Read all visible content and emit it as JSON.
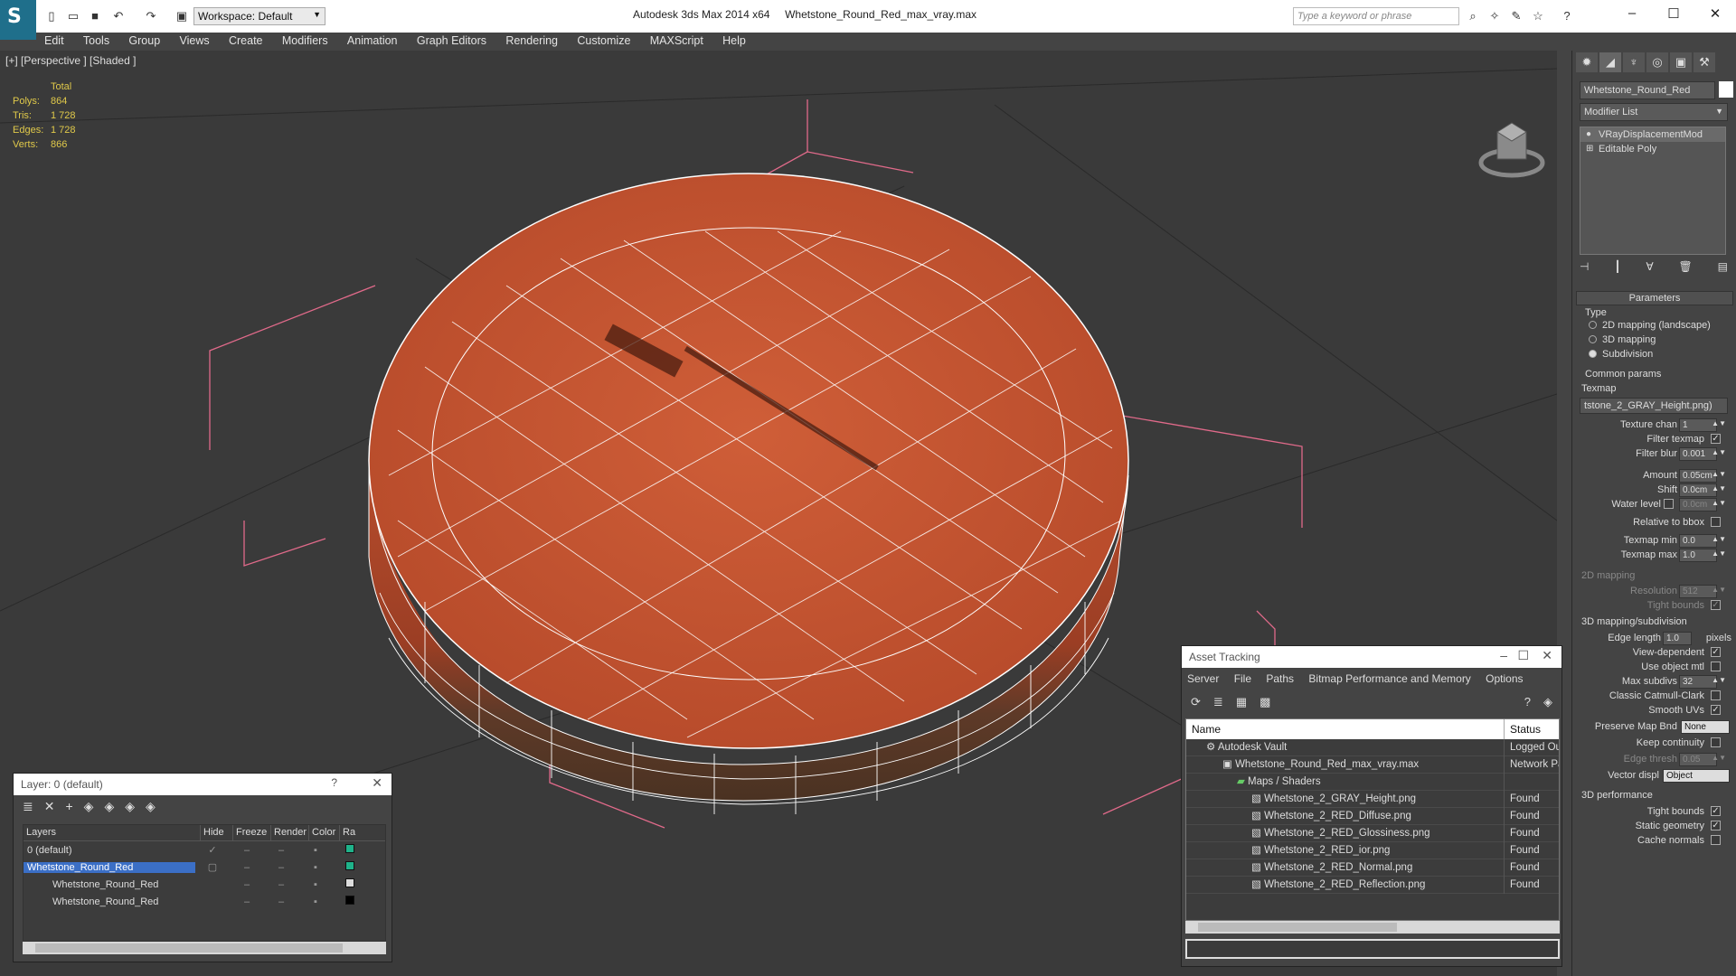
{
  "titlebar": {
    "app_name": "Autodesk 3ds Max  2014 x64",
    "file_name": "Whetstone_Round_Red_max_vray.max",
    "workspace_label": "Workspace: Default",
    "search_placeholder": "Type a keyword or phrase"
  },
  "menu": [
    "Edit",
    "Tools",
    "Group",
    "Views",
    "Create",
    "Modifiers",
    "Animation",
    "Graph Editors",
    "Rendering",
    "Customize",
    "MAXScript",
    "Help"
  ],
  "viewport": {
    "label": "[+] [Perspective ] [Shaded ]",
    "stats": {
      "header": "Total",
      "polys_label": "Polys:",
      "polys": "864",
      "tris_label": "Tris:",
      "tris": "1 728",
      "edges_label": "Edges:",
      "edges": "1 728",
      "verts_label": "Verts:",
      "verts": "866"
    },
    "colors": {
      "background": "#3a3a3a",
      "wire": "#ffffff",
      "surface": "#c5542f",
      "bounds": "#e06a8a"
    }
  },
  "command_panel": {
    "object_name": "Whetstone_Round_Red",
    "modifier_list": "Modifier List",
    "stack": [
      "VRayDisplacementMod",
      "Editable Poly"
    ],
    "parameters_title": "Parameters",
    "type_label": "Type",
    "types": [
      "2D mapping (landscape)",
      "3D mapping",
      "Subdivision"
    ],
    "common_params": "Common params",
    "texmap_label": "Texmap",
    "texmap_value": "tstone_2_GRAY_Height.png)",
    "texture_chan_label": "Texture chan",
    "texture_chan": "1",
    "filter_texmap": "Filter texmap",
    "filter_blur_label": "Filter blur",
    "filter_blur": "0.001",
    "amount_label": "Amount",
    "amount": "0.05cm",
    "shift_label": "Shift",
    "shift": "0.0cm",
    "water_level_label": "Water level",
    "water_level": "0.0cm",
    "relative_bbox": "Relative to bbox",
    "texmap_min_label": "Texmap min",
    "texmap_min": "0.0",
    "texmap_max_label": "Texmap max",
    "texmap_max": "1.0",
    "mapping2d": "2D mapping",
    "resolution_label": "Resolution",
    "resolution": "512",
    "tight_bounds": "Tight bounds",
    "mapping3d": "3D mapping/subdivision",
    "edge_length_label": "Edge length",
    "edge_length": "1.0",
    "pixels": "pixels",
    "view_dependent": "View-dependent",
    "use_object_mtl": "Use object mtl",
    "max_subdivs_label": "Max subdivs",
    "max_subdivs": "32",
    "classic_catmull": "Classic Catmull-Clark",
    "smooth_uvs": "Smooth UVs",
    "preserve_map_label": "Preserve Map Bnd",
    "preserve_map": "None",
    "keep_continuity": "Keep continuity",
    "edge_thresh_label": "Edge thresh",
    "edge_thresh": "0.05",
    "vector_displ_label": "Vector displ",
    "vector_displ": "Object",
    "performance": "3D performance",
    "perf_tight_bounds": "Tight bounds",
    "static_geometry": "Static geometry",
    "cache_normals": "Cache normals"
  },
  "layer_dialog": {
    "title": "Layer: 0 (default)",
    "help": "?",
    "columns": [
      "Layers",
      "Hide",
      "Freeze",
      "Render",
      "Color",
      "Ra"
    ],
    "rows": [
      {
        "name": "0 (default)",
        "color": "#1fb38a"
      },
      {
        "name": "Whetstone_Round_Red",
        "color": "#1fb38a"
      },
      {
        "name": "Whetstone_Round_Red",
        "color": "#dddddd"
      },
      {
        "name": "Whetstone_Round_Red",
        "color": "#000000"
      }
    ]
  },
  "asset_tracking": {
    "title": "Asset Tracking",
    "menu": [
      "Server",
      "File",
      "Paths",
      "Bitmap Performance and Memory",
      "Options"
    ],
    "columns": {
      "name": "Name",
      "status": "Status"
    },
    "rows": [
      {
        "name": "Autodesk Vault",
        "status": "Logged Ou"
      },
      {
        "name": "Whetstone_Round_Red_max_vray.max",
        "status": "Network Pa"
      },
      {
        "name": "Maps / Shaders",
        "status": ""
      },
      {
        "name": "Whetstone_2_GRAY_Height.png",
        "status": "Found"
      },
      {
        "name": "Whetstone_2_RED_Diffuse.png",
        "status": "Found"
      },
      {
        "name": "Whetstone_2_RED_Glossiness.png",
        "status": "Found"
      },
      {
        "name": "Whetstone_2_RED_ior.png",
        "status": "Found"
      },
      {
        "name": "Whetstone_2_RED_Normal.png",
        "status": "Found"
      },
      {
        "name": "Whetstone_2_RED_Reflection.png",
        "status": "Found"
      }
    ]
  }
}
